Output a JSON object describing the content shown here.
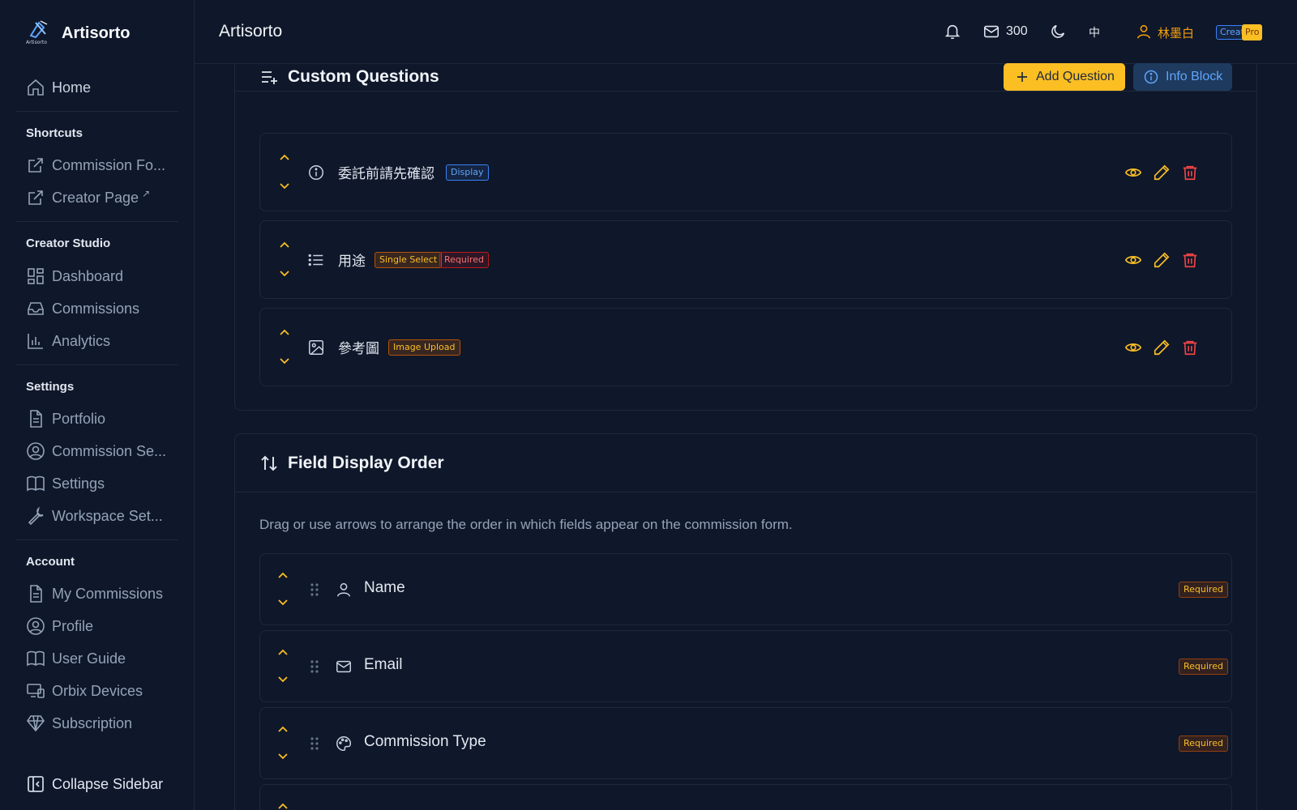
{
  "brand": {
    "name": "Artisorto",
    "logo_text": "Artisorto"
  },
  "header": {
    "title": "Artisorto",
    "mail_count": "300",
    "lang": "中",
    "user_name": "林墨白",
    "badge_creator": "Creator",
    "badge_pro": "Pro"
  },
  "sidebar": {
    "home": "Home",
    "shortcuts_heading": "Shortcuts",
    "shortcuts": [
      "Commission Fo...",
      "Creator Page"
    ],
    "studio_heading": "Creator Studio",
    "studio": [
      "Dashboard",
      "Commissions",
      "Analytics"
    ],
    "settings_heading": "Settings",
    "settings": [
      "Portfolio",
      "Commission Se...",
      "Settings",
      "Workspace Set..."
    ],
    "account_heading": "Account",
    "account": [
      "My Commissions",
      "Profile",
      "User Guide",
      "Orbix Devices",
      "Subscription"
    ],
    "collapse": "Collapse Sidebar"
  },
  "custom_questions": {
    "title": "Custom Questions",
    "add_button": "Add Question",
    "info_button": "Info Block",
    "items": [
      {
        "title": "委託前請先確認",
        "tags": [
          "Display"
        ],
        "icon": "info-icon"
      },
      {
        "title": "用途",
        "tags": [
          "Single Select",
          "Required"
        ],
        "icon": "list-icon"
      },
      {
        "title": "參考圖",
        "tags": [
          "Image Upload"
        ],
        "icon": "image-icon"
      }
    ]
  },
  "field_order": {
    "title": "Field Display Order",
    "description": "Drag or use arrows to arrange the order in which fields appear on the commission form.",
    "fields": [
      {
        "title": "Name",
        "tag": "Required",
        "icon": "user-icon"
      },
      {
        "title": "Email",
        "tag": "Required",
        "icon": "mail-icon"
      },
      {
        "title": "Commission Type",
        "tag": "Required",
        "icon": "palette-icon"
      }
    ]
  },
  "colors": {
    "accent": "#fbbf24",
    "info": "#60a5fa",
    "danger": "#ef4444",
    "bg": "#0f172a"
  }
}
